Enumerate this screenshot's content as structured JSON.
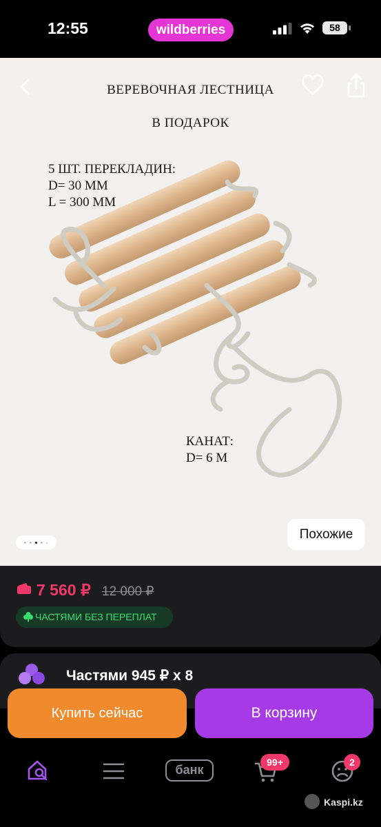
{
  "status_bar": {
    "time": "12:55",
    "app_pill": "wildberries",
    "battery": "58"
  },
  "product_image": {
    "title_line1": "ВЕРЕВОЧНАЯ ЛЕСТНИЦА",
    "title_line2": "В ПОДАРОК",
    "spec_line1": "5 ШТ. ПЕРЕКЛАДИН:",
    "spec_line2": "D= 30 ММ",
    "spec_line3": "L = 300 ММ",
    "rope_line1": "КАНАТ:",
    "rope_line2": "D= 6 М",
    "similar_button": "Похожие",
    "gallery_dots": 5,
    "gallery_active_index": 2
  },
  "price": {
    "current": "7 560 ₽",
    "old": "12 000 ₽",
    "badge": "ЧАСТЯМИ БЕЗ ПЕРЕПЛАТ",
    "accent_color": "#f0386b"
  },
  "installment": {
    "text": "Частями 945 ₽ x 8"
  },
  "actions": {
    "buy_now": "Купить сейчас",
    "add_to_cart": "В корзину"
  },
  "tabbar": {
    "items": [
      "home-search-icon",
      "menu-icon",
      "bank",
      "cart-icon",
      "profile-icon"
    ],
    "bank_label": "банк",
    "cart_badge": "99+",
    "profile_badge": "2"
  },
  "watermark": "Kaspi.kz"
}
